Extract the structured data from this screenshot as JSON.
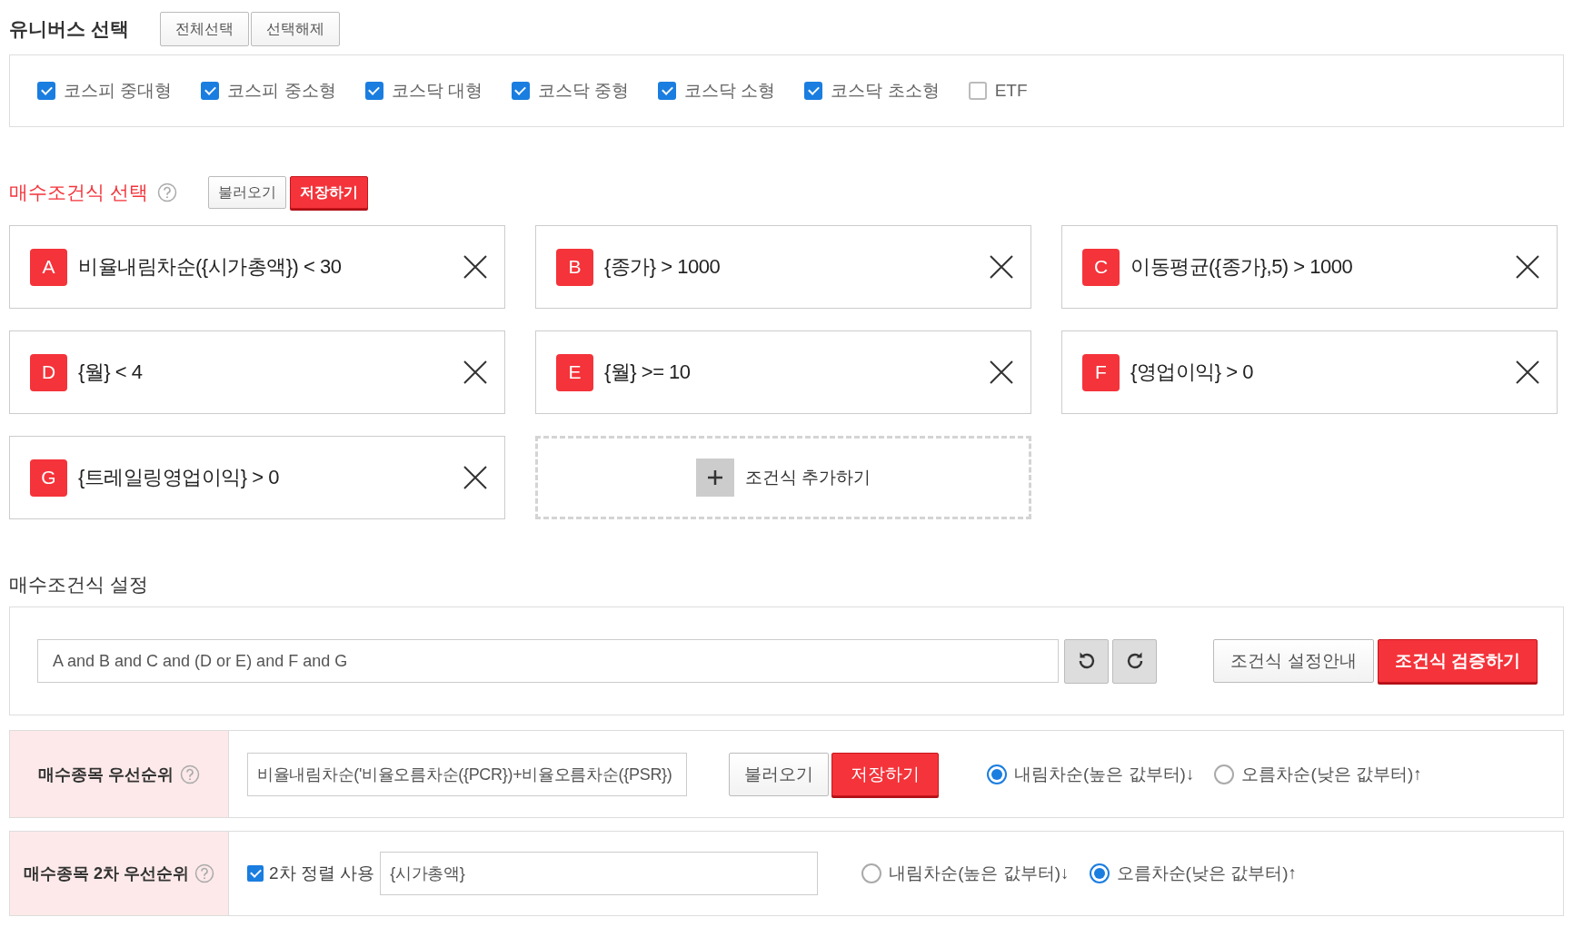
{
  "universe": {
    "title": "유니버스 선택",
    "buttons": [
      "전체선택",
      "선택해제"
    ],
    "options": [
      {
        "label": "코스피 중대형",
        "checked": true
      },
      {
        "label": "코스피 중소형",
        "checked": true
      },
      {
        "label": "코스닥 대형",
        "checked": true
      },
      {
        "label": "코스닥 중형",
        "checked": true
      },
      {
        "label": "코스닥 소형",
        "checked": true
      },
      {
        "label": "코스닥 초소형",
        "checked": true
      },
      {
        "label": "ETF",
        "checked": false
      }
    ]
  },
  "buy_conditions": {
    "title": "매수조건식 선택",
    "buttons": [
      {
        "label": "불러오기",
        "kind": "default"
      },
      {
        "label": "저장하기",
        "kind": "primary"
      }
    ],
    "conditions": [
      {
        "letter": "A",
        "expression": "비율내림차순({시가총액}) < 30"
      },
      {
        "letter": "B",
        "expression": "{종가} > 1000"
      },
      {
        "letter": "C",
        "expression": "이동평균({종가},5) > 1000"
      },
      {
        "letter": "D",
        "expression": "{월} < 4"
      },
      {
        "letter": "E",
        "expression": "{월} >= 10"
      },
      {
        "letter": "F",
        "expression": "{영업이익} > 0"
      },
      {
        "letter": "G",
        "expression": "{트레일링영업이익} > 0"
      }
    ],
    "add_button": "조건식 추가하기"
  },
  "settings": {
    "title": "매수조건식 설정",
    "expression": "A and B and C and (D or E) and F and G",
    "buttons": [
      {
        "label": "조건식 설정안내",
        "kind": "default"
      },
      {
        "label": "조건식 검증하기",
        "kind": "primary"
      }
    ]
  },
  "priority": {
    "label": "매수종목 우선순위",
    "value": "비율내림차순('비율오름차순({PCR})+비율오름차순({PSR})",
    "buttons": [
      {
        "label": "불러오기",
        "kind": "default"
      },
      {
        "label": "저장하기",
        "kind": "primary"
      }
    ],
    "sort_options": [
      {
        "label": "내림차순(높은 값부터)↓",
        "selected": true
      },
      {
        "label": "오름차순(낮은 값부터)↑",
        "selected": false
      }
    ]
  },
  "secondary_priority": {
    "label": "매수종목 2차 우선순위",
    "use_label": "2차 정렬 사용",
    "use_checked": true,
    "value": "{시가총액}",
    "sort_options": [
      {
        "label": "내림차순(높은 값부터)↓",
        "selected": false
      },
      {
        "label": "오름차순(낮은 값부터)↑",
        "selected": true
      }
    ]
  }
}
